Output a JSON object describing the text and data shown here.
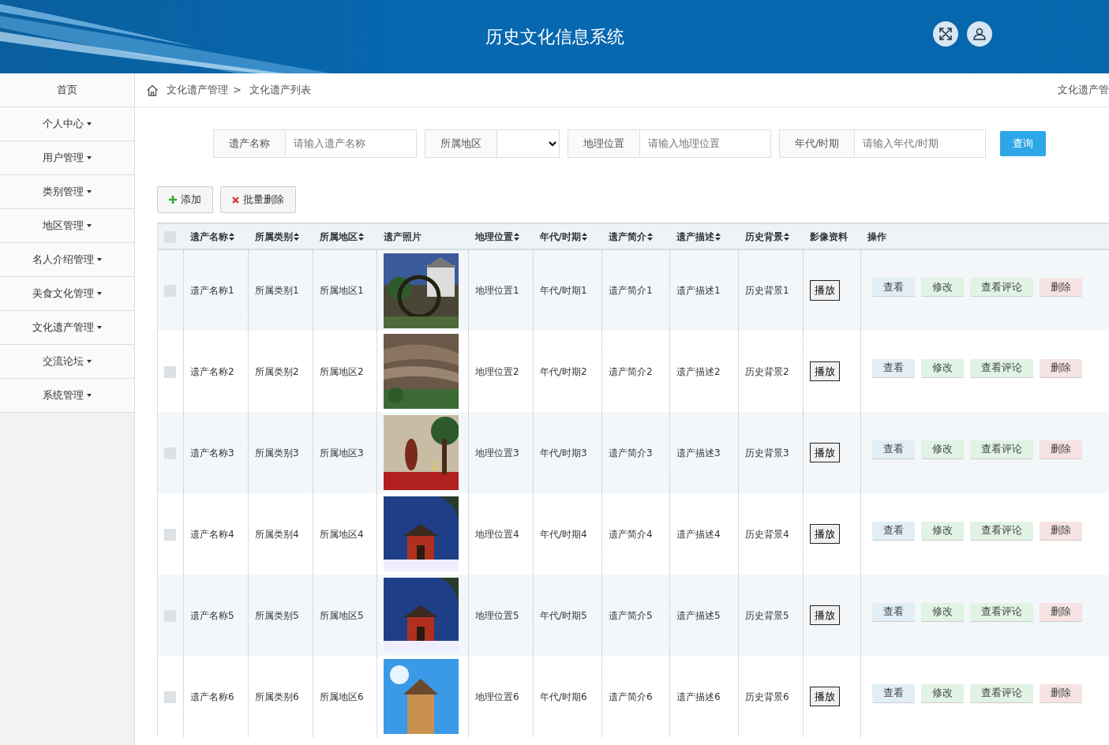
{
  "header": {
    "title": "历史文化信息系统"
  },
  "sidebar": {
    "items": [
      {
        "label": "首页",
        "dropdown": false
      },
      {
        "label": "个人中心",
        "dropdown": true
      },
      {
        "label": "用户管理",
        "dropdown": true
      },
      {
        "label": "类别管理",
        "dropdown": true
      },
      {
        "label": "地区管理",
        "dropdown": true
      },
      {
        "label": "名人介绍管理",
        "dropdown": true
      },
      {
        "label": "美食文化管理",
        "dropdown": true
      },
      {
        "label": "文化遗产管理",
        "dropdown": true
      },
      {
        "label": "交流论坛",
        "dropdown": true
      },
      {
        "label": "系统管理",
        "dropdown": true
      }
    ]
  },
  "breadcrumb": {
    "items": [
      "文化遗产管理",
      "文化遗产列表"
    ],
    "separator": ">",
    "right_text": "文化遗产管"
  },
  "filters": [
    {
      "kind": "text",
      "label": "遗产名称",
      "placeholder": "请输入遗产名称"
    },
    {
      "kind": "select",
      "label": "所属地区"
    },
    {
      "kind": "text",
      "label": "地理位置",
      "placeholder": "请输入地理位置"
    },
    {
      "kind": "text",
      "label": "年代/时期",
      "placeholder": "请输入年代/时期"
    }
  ],
  "search_button": "查询",
  "toolbar": [
    {
      "kind": "add",
      "label": "添加"
    },
    {
      "kind": "delete",
      "label": "批量删除"
    }
  ],
  "table": {
    "select_all": {
      "checked": false
    },
    "columns": [
      {
        "label": "遗产名称",
        "sortable": true
      },
      {
        "label": "所属类别",
        "sortable": true
      },
      {
        "label": "所属地区",
        "sortable": true
      },
      {
        "label": "遗产照片",
        "sortable": false
      },
      {
        "label": "地理位置",
        "sortable": true
      },
      {
        "label": "年代/时期",
        "sortable": true
      },
      {
        "label": "遗产简介",
        "sortable": true
      },
      {
        "label": "遗产描述",
        "sortable": true
      },
      {
        "label": "历史背景",
        "sortable": true
      },
      {
        "label": "影像资料",
        "sortable": false
      },
      {
        "label": "操作",
        "sortable": false
      }
    ],
    "rows": [
      {
        "checked": false,
        "cells": [
          "遗产名称1",
          "所属类别1",
          "所属地区1",
          {
            "kind": "picture"
          },
          "地理位置1",
          "年代/时期1",
          "遗产简介1",
          "遗产描述1",
          "历史背景1",
          {
            "kind": "button",
            "label": "播放"
          },
          {
            "kind": "actions",
            "actions": [
              {
                "kind": "view",
                "label": "查看"
              },
              {
                "kind": "edit",
                "label": "修改"
              },
              {
                "kind": "comments",
                "label": "查看评论"
              },
              {
                "kind": "delete",
                "label": "删除"
              }
            ]
          }
        ]
      },
      {
        "checked": false,
        "cells": [
          "遗产名称2",
          "所属类别2",
          "所属地区2",
          {
            "kind": "picture"
          },
          "地理位置2",
          "年代/时期2",
          "遗产简介2",
          "遗产描述2",
          "历史背景2",
          {
            "kind": "button",
            "label": "播放"
          },
          {
            "kind": "actions",
            "actions": [
              {
                "kind": "view",
                "label": "查看"
              },
              {
                "kind": "edit",
                "label": "修改"
              },
              {
                "kind": "comments",
                "label": "查看评论"
              },
              {
                "kind": "delete",
                "label": "删除"
              }
            ]
          }
        ]
      },
      {
        "checked": false,
        "cells": [
          "遗产名称3",
          "所属类别3",
          "所属地区3",
          {
            "kind": "picture"
          },
          "地理位置3",
          "年代/时期3",
          "遗产简介3",
          "遗产描述3",
          "历史背景3",
          {
            "kind": "button",
            "label": "播放"
          },
          {
            "kind": "actions",
            "actions": [
              {
                "kind": "view",
                "label": "查看"
              },
              {
                "kind": "edit",
                "label": "修改"
              },
              {
                "kind": "comments",
                "label": "查看评论"
              },
              {
                "kind": "delete",
                "label": "删除"
              }
            ]
          }
        ]
      },
      {
        "checked": false,
        "cells": [
          "遗产名称4",
          "所属类别4",
          "所属地区4",
          {
            "kind": "picture"
          },
          "地理位置4",
          "年代/时期4",
          "遗产简介4",
          "遗产描述4",
          "历史背景4",
          {
            "kind": "button",
            "label": "播放"
          },
          {
            "kind": "actions",
            "actions": [
              {
                "kind": "view",
                "label": "查看"
              },
              {
                "kind": "edit",
                "label": "修改"
              },
              {
                "kind": "comments",
                "label": "查看评论"
              },
              {
                "kind": "delete",
                "label": "删除"
              }
            ]
          }
        ]
      },
      {
        "checked": false,
        "cells": [
          "遗产名称5",
          "所属类别5",
          "所属地区5",
          {
            "kind": "picture"
          },
          "地理位置5",
          "年代/时期5",
          "遗产简介5",
          "遗产描述5",
          "历史背景5",
          {
            "kind": "button",
            "label": "播放"
          },
          {
            "kind": "actions",
            "actions": [
              {
                "kind": "view",
                "label": "查看"
              },
              {
                "kind": "edit",
                "label": "修改"
              },
              {
                "kind": "comments",
                "label": "查看评论"
              },
              {
                "kind": "delete",
                "label": "删除"
              }
            ]
          }
        ]
      },
      {
        "checked": false,
        "cells": [
          "遗产名称6",
          "所属类别6",
          "所属地区6",
          {
            "kind": "picture"
          },
          "地理位置6",
          "年代/时期6",
          "遗产简介6",
          "遗产描述6",
          "历史背景6",
          {
            "kind": "button",
            "label": "播放"
          },
          {
            "kind": "actions",
            "actions": [
              {
                "kind": "view",
                "label": "查看"
              },
              {
                "kind": "edit",
                "label": "修改"
              },
              {
                "kind": "comments",
                "label": "查看评论"
              },
              {
                "kind": "delete",
                "label": "删除"
              }
            ]
          }
        ]
      }
    ]
  }
}
